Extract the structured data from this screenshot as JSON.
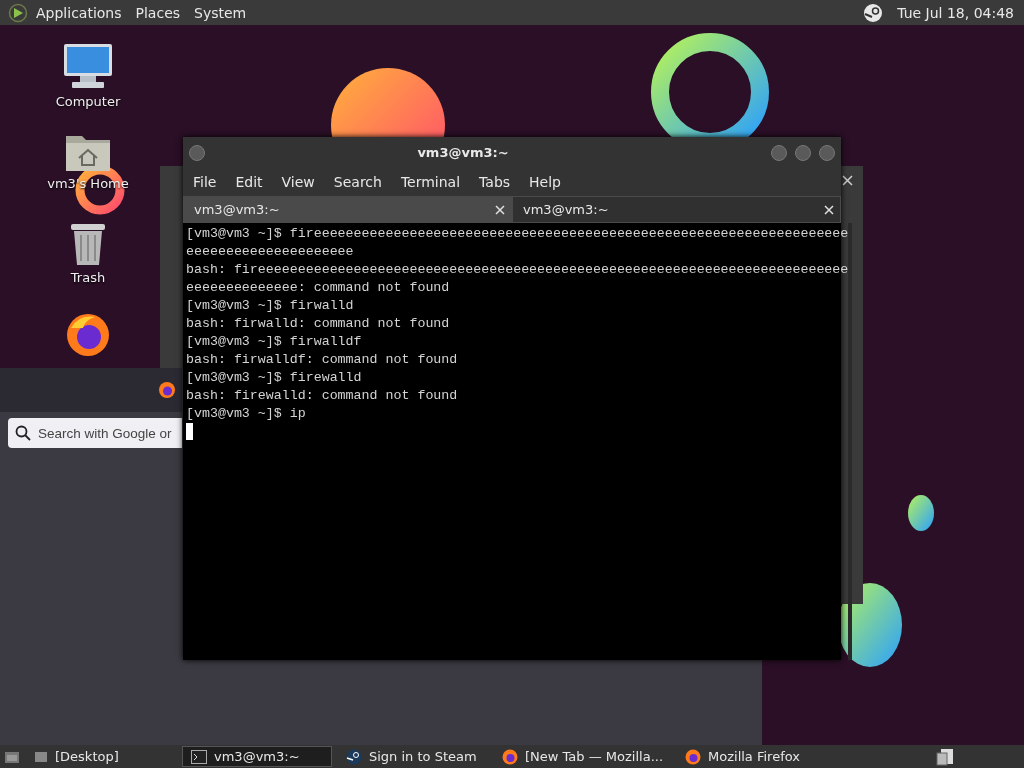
{
  "top_panel": {
    "menus": [
      "Applications",
      "Places",
      "System"
    ],
    "clock": "Tue Jul 18, 04:48"
  },
  "desktop_icons": [
    {
      "kind": "computer",
      "label": "Computer"
    },
    {
      "kind": "home",
      "label": "vm3's Home"
    },
    {
      "kind": "trash",
      "label": "Trash"
    },
    {
      "kind": "firefox"
    }
  ],
  "browser_window": {
    "search_placeholder": "Search with Google or"
  },
  "terminal": {
    "title": "vm3@vm3:~",
    "menu": [
      "File",
      "Edit",
      "View",
      "Search",
      "Terminal",
      "Tabs",
      "Help"
    ],
    "tabs": [
      {
        "label": "vm3@vm3:~",
        "selected": true
      },
      {
        "label": "vm3@vm3:~",
        "selected": false
      }
    ],
    "lines": [
      "[vm3@vm3 ~]$ fireeeeeeeeeeeeeeeeeeeeeeeeeeeeeeeeeeeeeeeeeeeeeeeeeeeeeeeeeeeeeeeeeee",
      "eeeeeeeeeeeeeeeeeeeee",
      "bash: fireeeeeeeeeeeeeeeeeeeeeeeeeeeeeeeeeeeeeeeeeeeeeeeeeeeeeeeeeeeeeeeeeeeeeeeeee",
      "eeeeeeeeeeeeee: command not found",
      "[vm3@vm3 ~]$ firwalld",
      "bash: firwalld: command not found",
      "[vm3@vm3 ~]$ firwalldf",
      "bash: firwalldf: command not found",
      "[vm3@vm3 ~]$ firewalld",
      "bash: firewalld: command not found",
      "[vm3@vm3 ~]$ ip"
    ]
  },
  "taskbar": {
    "items": [
      {
        "kind": "folder",
        "label": "[Desktop]",
        "selected": false
      },
      {
        "kind": "terminal",
        "label": "vm3@vm3:~",
        "selected": true
      },
      {
        "kind": "steam",
        "label": "Sign in to Steam",
        "selected": false
      },
      {
        "kind": "firefox",
        "label": "[New Tab — Mozilla...",
        "selected": false
      },
      {
        "kind": "firefox",
        "label": "Mozilla Firefox",
        "selected": false
      }
    ]
  }
}
